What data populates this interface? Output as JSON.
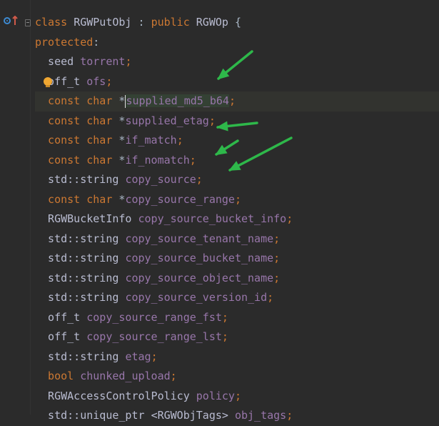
{
  "editor": {
    "lines": [
      {
        "tokens": [
          {
            "t": "class ",
            "c": "kw"
          },
          {
            "t": "RGWPutObj ",
            "c": "ty"
          },
          {
            "t": ": ",
            "c": "pl"
          },
          {
            "t": "public ",
            "c": "kw"
          },
          {
            "t": "RGWOp ",
            "c": "ty"
          },
          {
            "t": "{",
            "c": "pl"
          }
        ]
      },
      {
        "tokens": [
          {
            "t": "protected",
            "c": "kw"
          },
          {
            "t": ":",
            "c": "pl"
          }
        ]
      },
      {
        "tokens": [
          {
            "t": "  seed ",
            "c": "ty"
          },
          {
            "t": "torrent",
            "c": "fld"
          },
          {
            "t": ";",
            "c": "pn"
          }
        ]
      },
      {
        "tokens": [
          {
            "t": "  off_t ",
            "c": "ty"
          },
          {
            "t": "ofs",
            "c": "fld"
          },
          {
            "t": ";",
            "c": "pn"
          }
        ]
      },
      {
        "tokens": [
          {
            "t": "  const char ",
            "c": "kw"
          },
          {
            "t": "*",
            "c": "pl"
          },
          {
            "t": "supplied_md5_b64",
            "c": "fld"
          },
          {
            "t": ";",
            "c": "pn"
          }
        ],
        "highlight": true,
        "selected_token": 2
      },
      {
        "tokens": [
          {
            "t": "  const char ",
            "c": "kw"
          },
          {
            "t": "*",
            "c": "pl"
          },
          {
            "t": "supplied_etag",
            "c": "fld"
          },
          {
            "t": ";",
            "c": "pn"
          }
        ]
      },
      {
        "tokens": [
          {
            "t": "  const char ",
            "c": "kw"
          },
          {
            "t": "*",
            "c": "pl"
          },
          {
            "t": "if_match",
            "c": "fld"
          },
          {
            "t": ";",
            "c": "pn"
          }
        ]
      },
      {
        "tokens": [
          {
            "t": "  const char ",
            "c": "kw"
          },
          {
            "t": "*",
            "c": "pl"
          },
          {
            "t": "if_nomatch",
            "c": "fld"
          },
          {
            "t": ";",
            "c": "pn"
          }
        ]
      },
      {
        "tokens": [
          {
            "t": "  std::string ",
            "c": "ty"
          },
          {
            "t": "copy_source",
            "c": "fld"
          },
          {
            "t": ";",
            "c": "pn"
          }
        ]
      },
      {
        "tokens": [
          {
            "t": "  const char ",
            "c": "kw"
          },
          {
            "t": "*",
            "c": "pl"
          },
          {
            "t": "copy_source_range",
            "c": "fld"
          },
          {
            "t": ";",
            "c": "pn"
          }
        ]
      },
      {
        "tokens": [
          {
            "t": "  RGWBucketInfo ",
            "c": "ty"
          },
          {
            "t": "copy_source_bucket_info",
            "c": "fld"
          },
          {
            "t": ";",
            "c": "pn"
          }
        ]
      },
      {
        "tokens": [
          {
            "t": "  std::string ",
            "c": "ty"
          },
          {
            "t": "copy_source_tenant_name",
            "c": "fld"
          },
          {
            "t": ";",
            "c": "pn"
          }
        ]
      },
      {
        "tokens": [
          {
            "t": "  std::string ",
            "c": "ty"
          },
          {
            "t": "copy_source_bucket_name",
            "c": "fld"
          },
          {
            "t": ";",
            "c": "pn"
          }
        ]
      },
      {
        "tokens": [
          {
            "t": "  std::string ",
            "c": "ty"
          },
          {
            "t": "copy_source_object_name",
            "c": "fld"
          },
          {
            "t": ";",
            "c": "pn"
          }
        ]
      },
      {
        "tokens": [
          {
            "t": "  std::string ",
            "c": "ty"
          },
          {
            "t": "copy_source_version_id",
            "c": "fld"
          },
          {
            "t": ";",
            "c": "pn"
          }
        ]
      },
      {
        "tokens": [
          {
            "t": "  off_t ",
            "c": "ty"
          },
          {
            "t": "copy_source_range_fst",
            "c": "fld"
          },
          {
            "t": ";",
            "c": "pn"
          }
        ]
      },
      {
        "tokens": [
          {
            "t": "  off_t ",
            "c": "ty"
          },
          {
            "t": "copy_source_range_lst",
            "c": "fld"
          },
          {
            "t": ";",
            "c": "pn"
          }
        ]
      },
      {
        "tokens": [
          {
            "t": "  std::string ",
            "c": "ty"
          },
          {
            "t": "etag",
            "c": "fld"
          },
          {
            "t": ";",
            "c": "pn"
          }
        ]
      },
      {
        "tokens": [
          {
            "t": "  bool ",
            "c": "kw"
          },
          {
            "t": "chunked_upload",
            "c": "fld"
          },
          {
            "t": ";",
            "c": "pn"
          }
        ]
      },
      {
        "tokens": [
          {
            "t": "  RGWAccessControlPolicy ",
            "c": "ty"
          },
          {
            "t": "policy",
            "c": "fld"
          },
          {
            "t": ";",
            "c": "pn"
          }
        ]
      },
      {
        "tokens": [
          {
            "t": "  std::unique_ptr ",
            "c": "ty"
          },
          {
            "t": "<RGWObjTags> ",
            "c": "ty"
          },
          {
            "t": "obj_tags",
            "c": "fld"
          },
          {
            "t": ";",
            "c": "pn"
          }
        ]
      }
    ]
  },
  "gutter": {
    "icons": [
      "override-icon",
      "implemented-arrow-icon",
      "fold-icon",
      "intention-bulb-icon"
    ]
  },
  "annotations": {
    "arrow_color": "#2eb84a"
  },
  "colors": {
    "background": "#2b2b2b",
    "keyword": "#cc7832",
    "field": "#9876aa",
    "type": "#b9bcd1"
  }
}
